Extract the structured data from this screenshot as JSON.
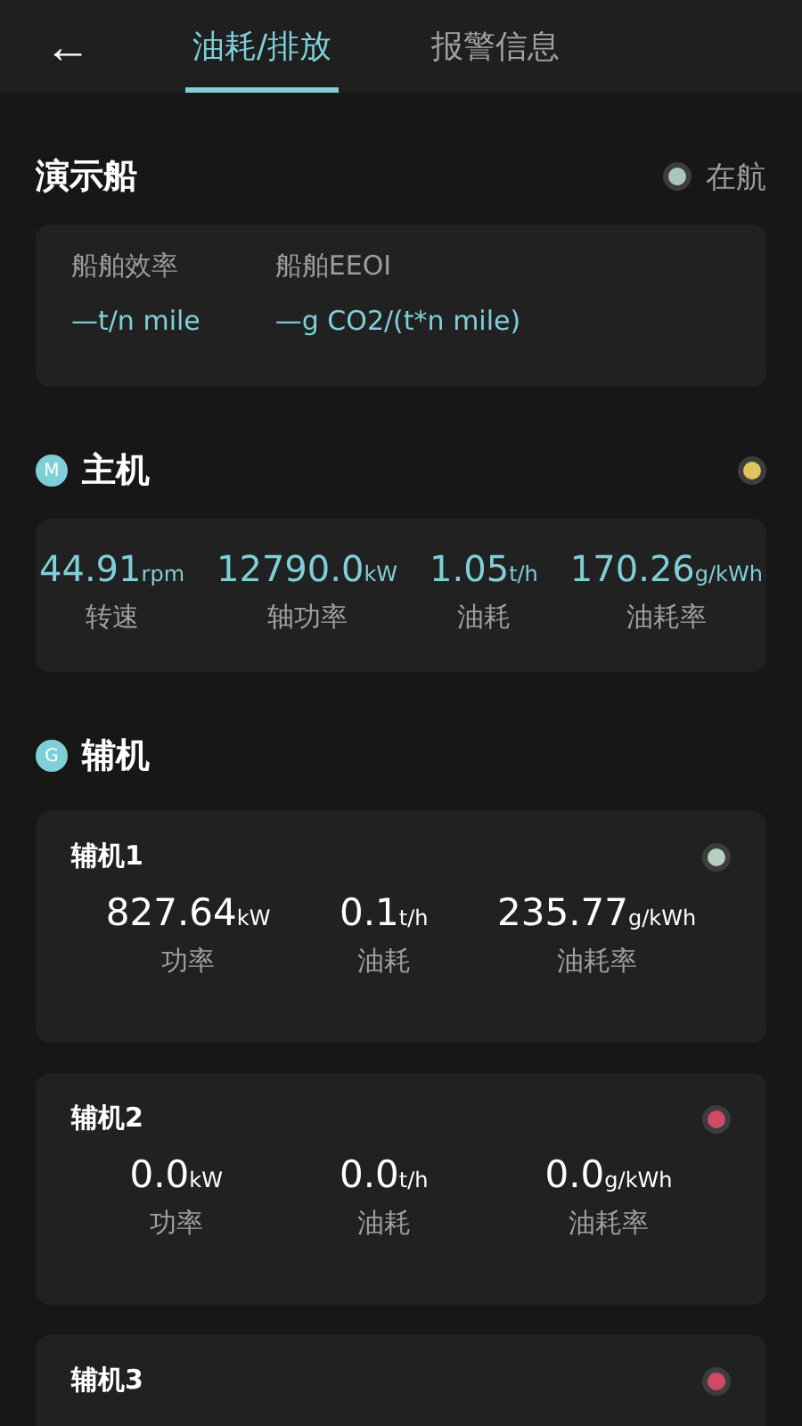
{
  "header": {
    "back": "←",
    "tabs": [
      {
        "label": "油耗/排放",
        "selected": true
      },
      {
        "label": "报警信息",
        "selected": false
      }
    ]
  },
  "ship": {
    "name": "演示船",
    "status": "在航",
    "color": "#a9c7b6"
  },
  "efficiency": [
    {
      "label": "船舶效率",
      "value": "—",
      "unit": "t/n mile"
    },
    {
      "label": "船舶EEOI",
      "value": "—",
      "unit": "g CO2/(t*n mile)"
    }
  ],
  "main_engine": {
    "badge": "M",
    "title": "主机",
    "color": "#e3c35e",
    "metrics": [
      {
        "value": "44.91",
        "unit": "rpm",
        "label": "转速"
      },
      {
        "value": "12790.0",
        "unit": "kW",
        "label": "轴功率"
      },
      {
        "value": "1.05",
        "unit": "t/h",
        "label": "油耗"
      },
      {
        "value": "170.26",
        "unit": "g/kWh",
        "label": "油耗率"
      }
    ]
  },
  "aux_engines": {
    "badge": "G",
    "title": "辅机",
    "units": [
      {
        "name": "辅机1",
        "color": "#b5cfc0",
        "metrics": [
          {
            "value": "827.64",
            "unit": "kW",
            "label": "功率"
          },
          {
            "value": "0.1",
            "unit": "t/h",
            "label": "油耗"
          },
          {
            "value": "235.77",
            "unit": "g/kWh",
            "label": "油耗率"
          }
        ]
      },
      {
        "name": "辅机2",
        "color": "#d04a64",
        "metrics": [
          {
            "value": "0.0",
            "unit": "kW",
            "label": "功率"
          },
          {
            "value": "0.0",
            "unit": "t/h",
            "label": "油耗"
          },
          {
            "value": "0.0",
            "unit": "g/kWh",
            "label": "油耗率"
          }
        ]
      },
      {
        "name": "辅机3",
        "color": "#d04a64"
      }
    ]
  }
}
